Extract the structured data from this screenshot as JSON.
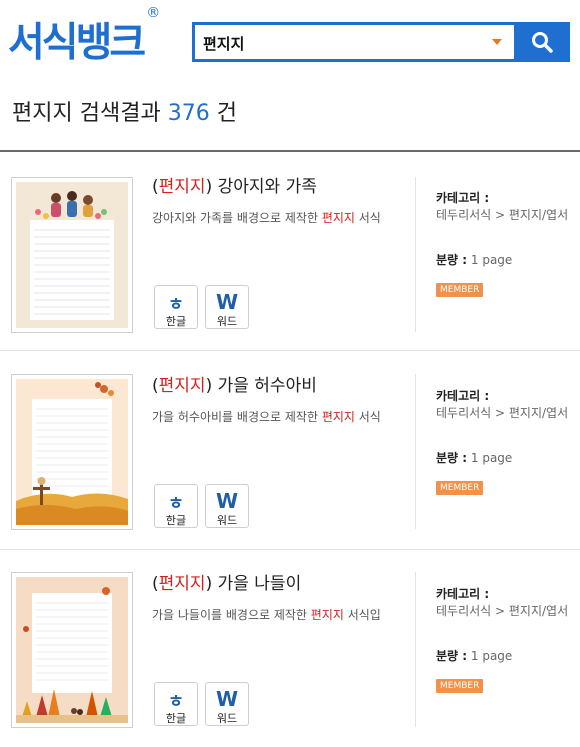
{
  "header": {
    "logo": "서식뱅크",
    "logo_mark": "®",
    "search_value": "편지지"
  },
  "results": {
    "keyword": "편지지",
    "label": "검색결과",
    "count": "376",
    "unit": "건"
  },
  "items": [
    {
      "title_open": "(",
      "title_kw": "편지지",
      "title_close": ")",
      "title_rest": "강아지와 가족",
      "desc_before": "강아지와 가족를 배경으로 제작한 ",
      "desc_kw": "편지지",
      "desc_after": " 서식",
      "btn_hwp": "한글",
      "btn_word": "워드",
      "category_label": "카테고리 :",
      "category_value": "테두리서식 > 편지지/엽서",
      "pages_label": "분량 :",
      "pages_value": "1 page",
      "badge": "MEMBER"
    },
    {
      "title_open": "(",
      "title_kw": "편지지",
      "title_close": ")",
      "title_rest": "가을 허수아비",
      "desc_before": "가을 허수아비를 배경으로 제작한 ",
      "desc_kw": "편지지",
      "desc_after": " 서식",
      "btn_hwp": "한글",
      "btn_word": "워드",
      "category_label": "카테고리 :",
      "category_value": "테두리서식 > 편지지/엽서",
      "pages_label": "분량 :",
      "pages_value": "1 page",
      "badge": "MEMBER"
    },
    {
      "title_open": "(",
      "title_kw": "편지지",
      "title_close": ")",
      "title_rest": "가을 나들이",
      "desc_before": "가을 나들이를 배경으로 제작한 ",
      "desc_kw": "편지지",
      "desc_after": " 서식입",
      "btn_hwp": "한글",
      "btn_word": "워드",
      "category_label": "카테고리 :",
      "category_value": "테두리서식 > 편지지/엽서",
      "pages_label": "분량 :",
      "pages_value": "1 page",
      "badge": "MEMBER"
    }
  ],
  "colors": {
    "brand": "#1f6fd0",
    "keyword": "#d0221e",
    "badge": "#f2914a"
  },
  "icons": {
    "search": "search-icon",
    "dropdown": "dropdown-caret-icon",
    "hwp": "hangul-hwp-icon",
    "word": "word-w-icon"
  }
}
